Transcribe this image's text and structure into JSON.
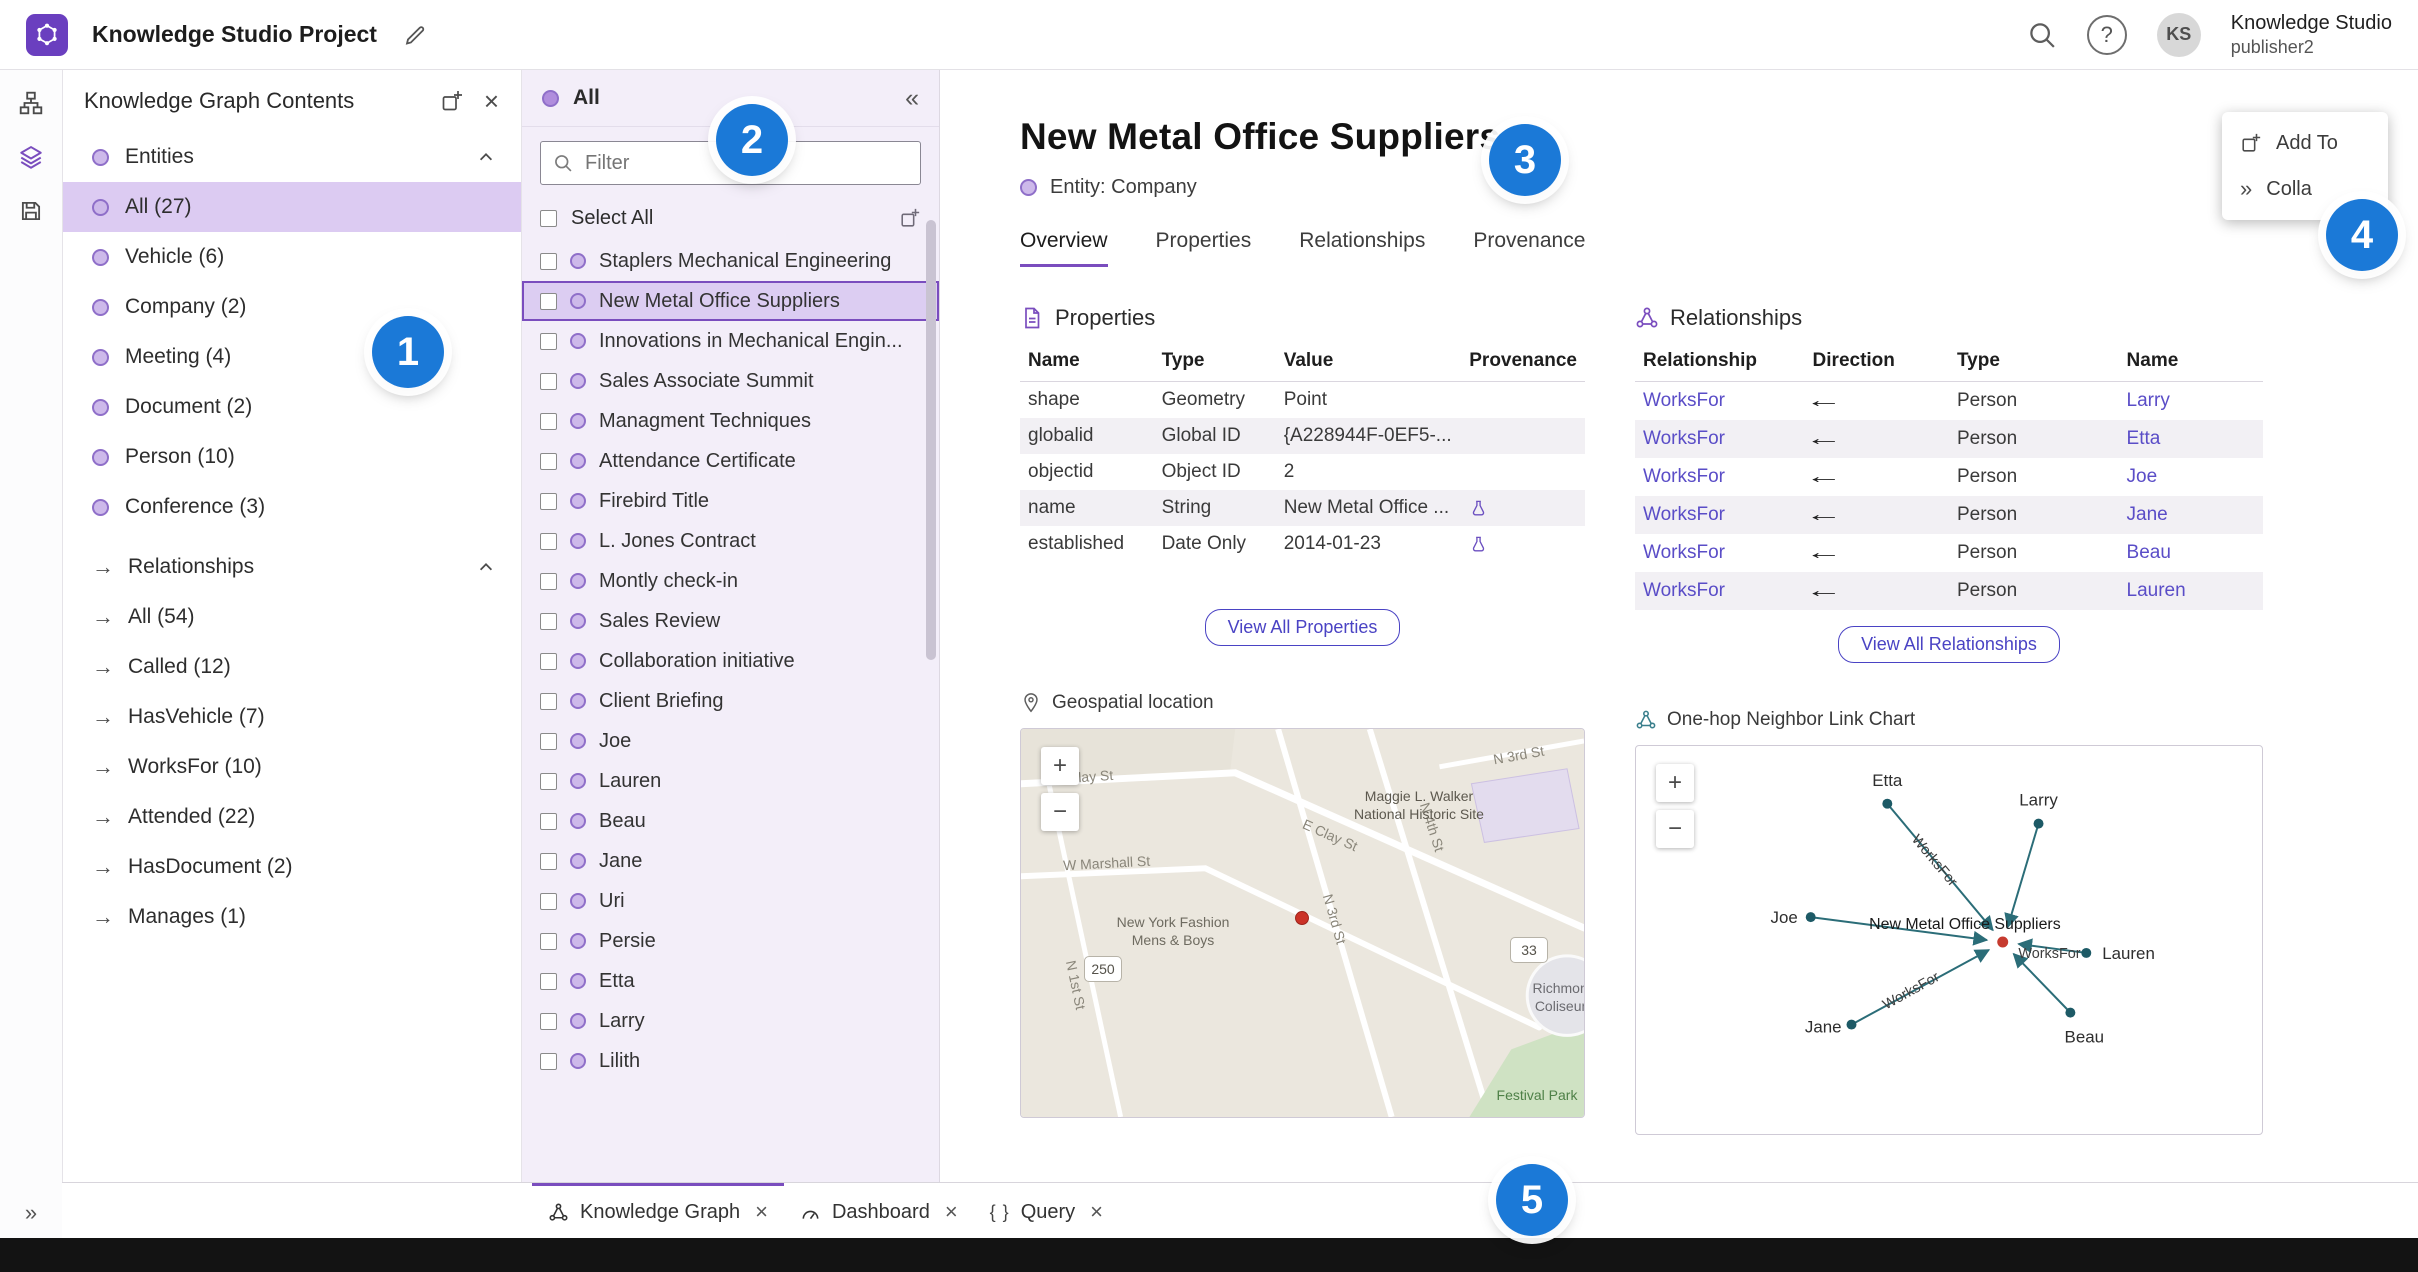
{
  "topbar": {
    "title": "Knowledge Studio Project",
    "user_initials": "KS",
    "user_line1": "Knowledge Studio",
    "user_line2": "publisher2"
  },
  "glyphs": {
    "help": "?",
    "zoom_in": "+",
    "zoom_out": "−"
  },
  "rail": {
    "expand": "»"
  },
  "contents_panel": {
    "title": "Knowledge Graph Contents",
    "close": "×",
    "entities_header": "Entities",
    "entities": [
      {
        "label": "All (27)"
      },
      {
        "label": "Vehicle (6)"
      },
      {
        "label": "Company (2)"
      },
      {
        "label": "Meeting (4)"
      },
      {
        "label": "Document (2)"
      },
      {
        "label": "Person (10)"
      },
      {
        "label": "Conference (3)"
      }
    ],
    "relationships_header": "Relationships",
    "arrow": "→",
    "relationships": [
      {
        "label": "All (54)"
      },
      {
        "label": "Called (12)"
      },
      {
        "label": "HasVehicle (7)"
      },
      {
        "label": "WorksFor (10)"
      },
      {
        "label": "Attended (22)"
      },
      {
        "label": "HasDocument (2)"
      },
      {
        "label": "Manages (1)"
      }
    ]
  },
  "list_panel": {
    "title": "All",
    "collapse": "«",
    "filter_placeholder": "Filter",
    "select_all": "Select All",
    "items": [
      "Staplers Mechanical Engineering",
      "New Metal Office Suppliers",
      "Innovations in Mechanical Engin...",
      "Sales Associate Summit",
      "Managment Techniques",
      "Attendance Certificate",
      "Firebird Title",
      "L. Jones Contract",
      "Montly check-in",
      "Sales Review",
      "Collaboration initiative",
      "Client Briefing",
      "Joe",
      "Lauren",
      "Beau",
      "Jane",
      "Uri",
      "Persie",
      "Etta",
      "Larry",
      "Lilith"
    ]
  },
  "detail": {
    "title": "New Metal Office Suppliers",
    "entity_label": "Entity: Company",
    "tabs": [
      "Overview",
      "Properties",
      "Relationships",
      "Provenance"
    ],
    "properties": {
      "section_title": "Properties",
      "headers": [
        "Name",
        "Type",
        "Value",
        "Provenance"
      ],
      "rows": [
        {
          "name": "shape",
          "type": "Geometry",
          "value": "Point"
        },
        {
          "name": "globalid",
          "type": "Global ID",
          "value": "{A228944F-0EF5-..."
        },
        {
          "name": "objectid",
          "type": "Object ID",
          "value": "2"
        },
        {
          "name": "name",
          "type": "String",
          "value": "New Metal Office ..."
        },
        {
          "name": "established",
          "type": "Date Only",
          "value": "2014-01-23"
        }
      ],
      "view_all": "View All Properties"
    },
    "relationships": {
      "section_title": "Relationships",
      "headers": [
        "Relationship",
        "Direction",
        "Type",
        "Name"
      ],
      "rows": [
        {
          "relationship": "WorksFor",
          "direction": "←",
          "type": "Person",
          "name": "Larry"
        },
        {
          "relationship": "WorksFor",
          "direction": "←",
          "type": "Person",
          "name": "Etta"
        },
        {
          "relationship": "WorksFor",
          "direction": "←",
          "type": "Person",
          "name": "Joe"
        },
        {
          "relationship": "WorksFor",
          "direction": "←",
          "type": "Person",
          "name": "Jane"
        },
        {
          "relationship": "WorksFor",
          "direction": "←",
          "type": "Person",
          "name": "Beau"
        },
        {
          "relationship": "WorksFor",
          "direction": "←",
          "type": "Person",
          "name": "Lauren"
        }
      ],
      "view_all": "View All Relationships"
    },
    "map": {
      "section_title": "Geospatial location",
      "streets": {
        "w_clay": "W Clay St",
        "e_clay": "E Clay St",
        "w_marshall": "W Marshall St",
        "n_1st": "N 1st St",
        "n_3rd": "N 3rd St",
        "n_4th": "N 4th St"
      },
      "landmarks": {
        "maggie": "Maggie L. Walker National Historic Site",
        "fashion": "New York Fashion Mens & Boys",
        "coliseum": "Richmond Coliseum",
        "festival": "Festival Park"
      },
      "routes": {
        "r250": "250",
        "r33": "33"
      }
    },
    "link_chart": {
      "section_title": "One-hop Neighbor Link Chart",
      "center_label": "New Metal Office Suppliers",
      "edge_label": "WorksFor",
      "nodes": [
        "Etta",
        "Larry",
        "Joe",
        "Lauren",
        "Jane",
        "Beau"
      ]
    }
  },
  "overlay": {
    "add_to": "Add To",
    "collapse_label": "Colla",
    "chevrons": "»"
  },
  "bottom_tabs": {
    "knowledge_graph": "Knowledge Graph",
    "dashboard": "Dashboard",
    "query": "Query",
    "query_icon": "{ }",
    "close": "×"
  },
  "badges": [
    "1",
    "2",
    "3",
    "4",
    "5"
  ]
}
